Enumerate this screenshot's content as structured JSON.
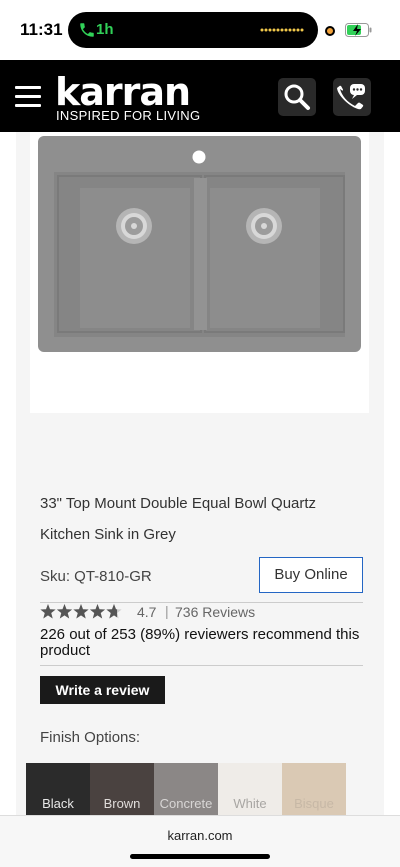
{
  "status_bar": {
    "time": "11:31",
    "call_duration": "1h"
  },
  "header": {
    "logo_word": "karran",
    "tagline": "INSPIRED FOR LIVING",
    "icons": [
      "menu-icon",
      "search-icon",
      "contact-chat-icon"
    ]
  },
  "product": {
    "title": "33\" Top Mount Double Equal Bowl Quartz Kitchen Sink in Grey",
    "sku": "Sku: QT-810-GR",
    "buy_label": "Buy Online",
    "rating": "4.7",
    "rating_separator": "|",
    "reviews": "736 Reviews",
    "stars_fraction": 0.94,
    "recommend_text": "226 out of 253 (89%) reviewers recommend this product",
    "write_review_label": "Write a review",
    "finish_label": "Finish Options:",
    "finishes": [
      {
        "name": "Black",
        "color": "#2b2b2b",
        "text_color": "#e8e8e8"
      },
      {
        "name": "Brown",
        "color": "#4a4240",
        "text_color": "#e0dcda"
      },
      {
        "name": "Concrete",
        "color": "#8b8786",
        "text_color": "#d8d6d5"
      },
      {
        "name": "White",
        "color": "#efece8",
        "text_color": "#a8a6a3"
      },
      {
        "name": "Bisque",
        "color": "#dac9b4",
        "text_color": "#c7b8a6"
      }
    ]
  },
  "browser": {
    "url": "karran.com"
  },
  "colors": {
    "header_bg": "#000000",
    "buy_border": "#2466c4",
    "call_green": "#31d158",
    "sink_grey": "#8f8f8f"
  }
}
